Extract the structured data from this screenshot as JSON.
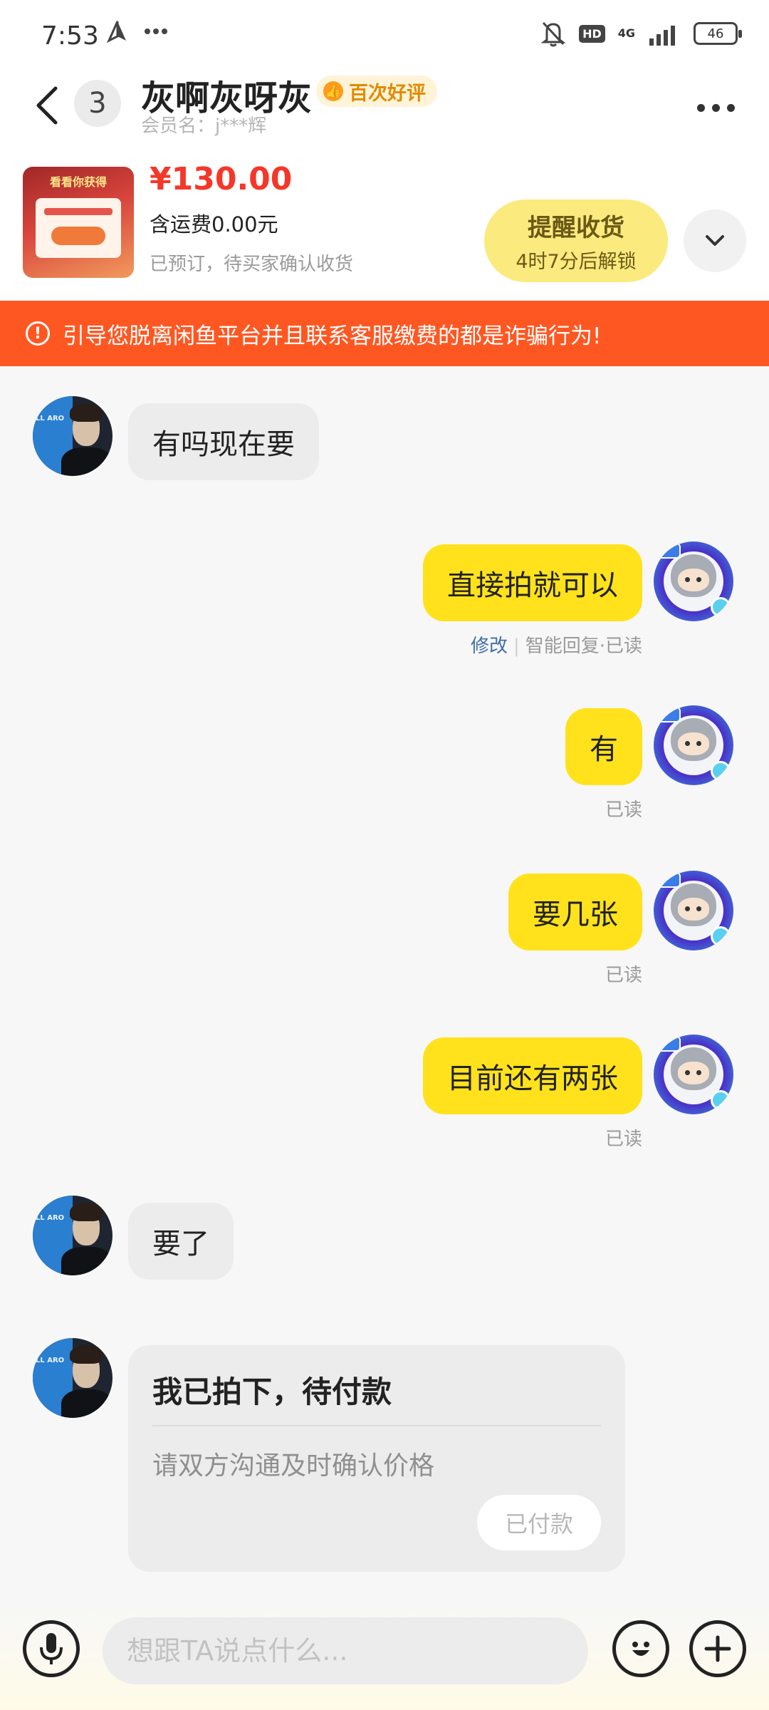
{
  "status_bar": {
    "time": "7:53",
    "hd": "HD",
    "network": "4G",
    "battery": "46"
  },
  "header": {
    "back_icon": "chevron-left-icon",
    "unread_count": "3",
    "contact_name": "灰啊灰呀灰",
    "rating_badge": "百次好评",
    "member_name": "会员名：j***辉",
    "more_icon": "more-dots-icon"
  },
  "product": {
    "thumb_title": "看看你获得",
    "price": "¥130.00",
    "shipping": "含运费0.00元",
    "status": "已预订，待买家确认收货",
    "remind_title": "提醒收货",
    "remind_sub": "4时7分后解锁",
    "expand_icon": "chevron-down-icon"
  },
  "warning": {
    "icon": "alert-circle-icon",
    "text": "引导您脱离闲鱼平台并且联系客服缴费的都是诈骗行为!"
  },
  "messages": [
    {
      "side": "in",
      "text": "有吗现在要"
    },
    {
      "side": "out",
      "text": "直接拍就可以",
      "meta_edit": "修改",
      "meta_rest": "智能回复·已读"
    },
    {
      "side": "out",
      "text": "有",
      "meta": "已读"
    },
    {
      "side": "out",
      "text": "要几张",
      "meta": "已读"
    },
    {
      "side": "out",
      "text": "目前还有两张",
      "meta": "已读"
    },
    {
      "side": "in",
      "text": "要了"
    }
  ],
  "order_card": {
    "title": "我已拍下，待付款",
    "desc": "请双方沟通及时确认价格",
    "button": "已付款"
  },
  "avatars": {
    "left_poster_text": "LL ARO"
  },
  "input_bar": {
    "voice_icon": "microphone-icon",
    "placeholder": "想跟TA说点什么...",
    "emoji_icon": "emoji-icon",
    "add_icon": "plus-icon"
  },
  "colors": {
    "accent_yellow": "#ffe21c",
    "warning": "#ff5722",
    "price": "#f5372a"
  }
}
